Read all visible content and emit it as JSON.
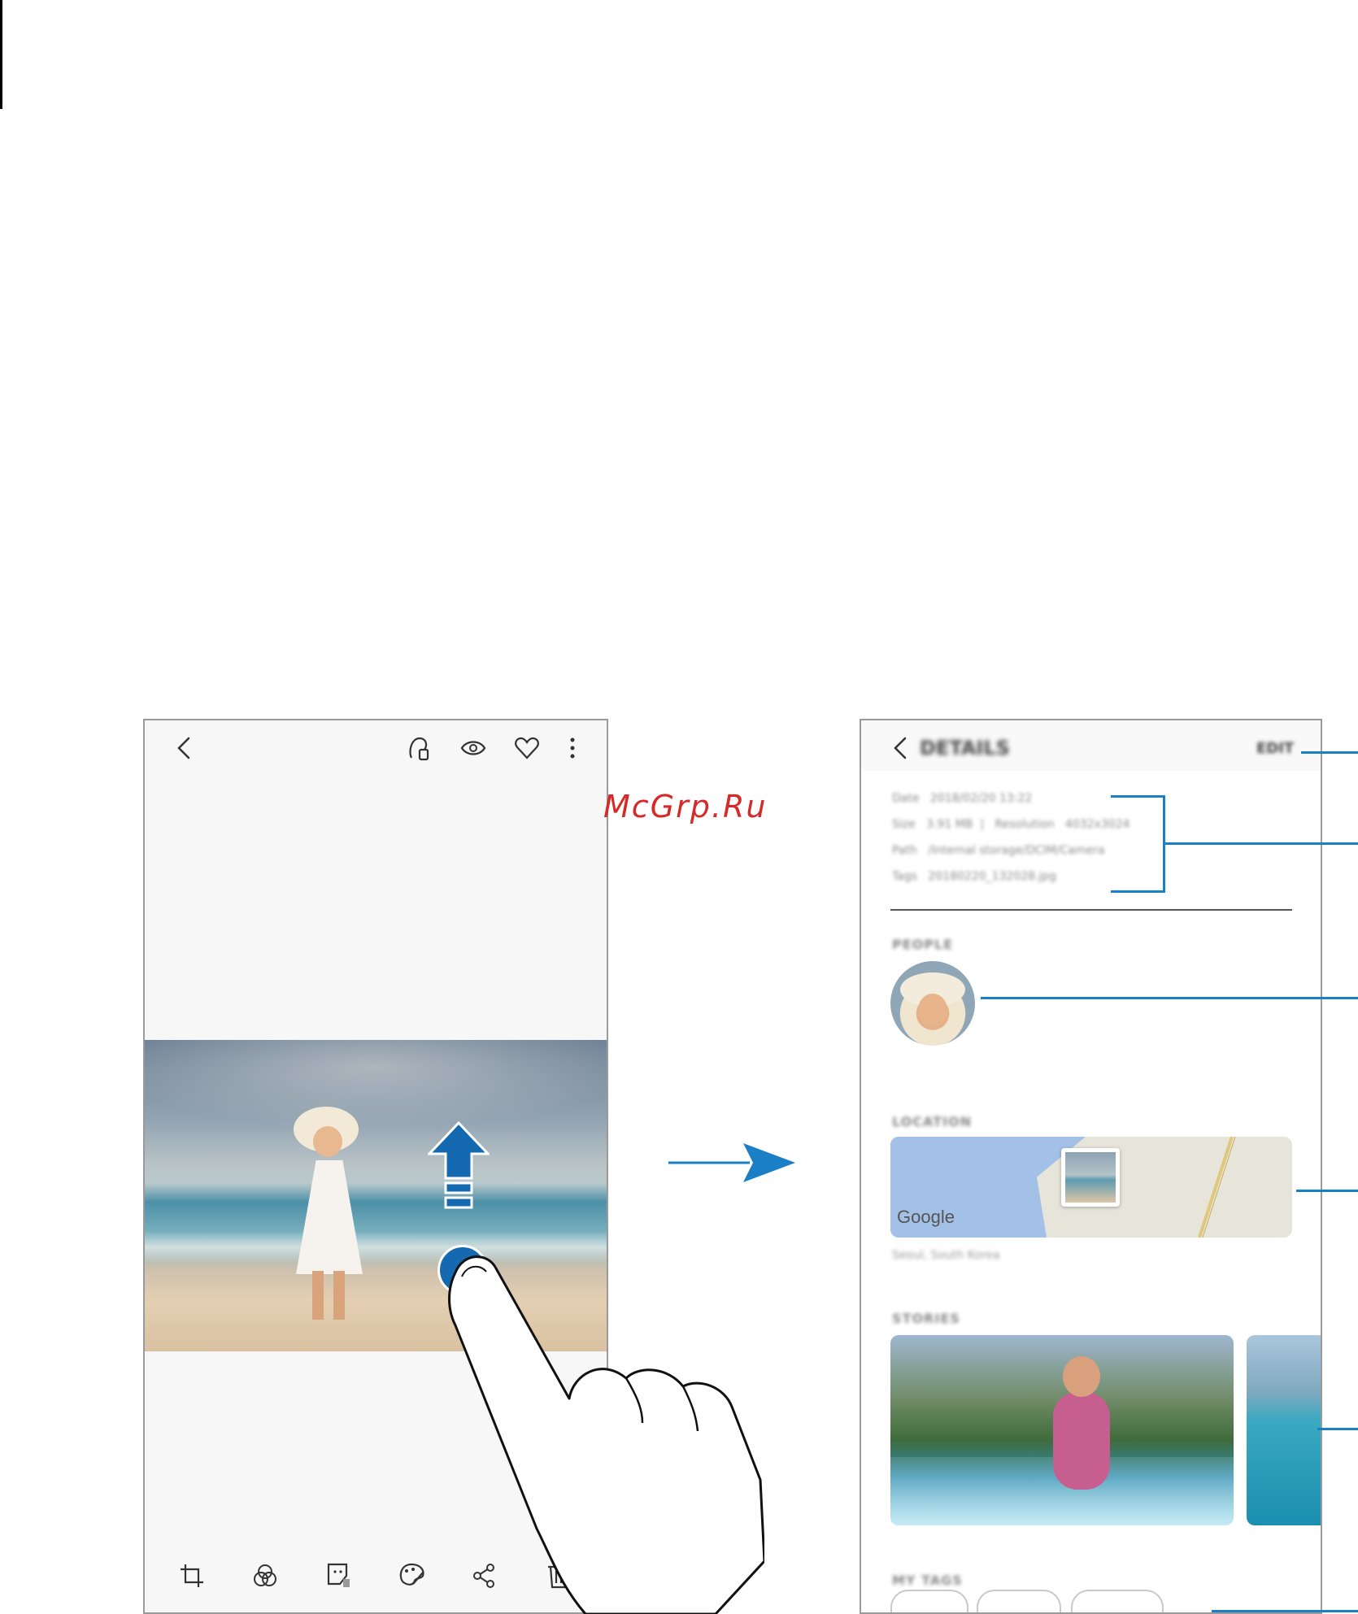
{
  "watermark": "McGrp.Ru",
  "colors": {
    "callout": "#1a7fc4",
    "arrow": "#1a7fc4",
    "border": "#9a9a9a",
    "screen_bg": "#f7f7f7"
  },
  "viewer": {
    "top_icons": [
      "back-icon",
      "bixby-vision-icon",
      "view-icon",
      "favorite-icon",
      "more-options-icon"
    ],
    "bottom_icons": [
      "crop-icon",
      "filter-icon",
      "sticker-icon",
      "paint-icon",
      "share-icon",
      "delete-icon"
    ]
  },
  "details": {
    "title": "DETAILS",
    "edit_label": "EDIT",
    "info_rows": [
      {
        "label": "Date",
        "value": "2018/02/20 13:22"
      },
      {
        "label": "Size",
        "value": "3.91 MB",
        "extra_label": "Resolution",
        "extra_value": "4032x3024"
      },
      {
        "label": "Path",
        "value": "/Internal storage/DCIM/Camera"
      },
      {
        "label": "Tags",
        "value": "20180220_132028.jpg"
      }
    ],
    "sections": {
      "people": "PEOPLE",
      "location": "LOCATION",
      "stories": "STORIES",
      "my_tags": "MY TAGS"
    },
    "map": {
      "brand": "Google",
      "address": "Seoul, South Korea"
    }
  }
}
